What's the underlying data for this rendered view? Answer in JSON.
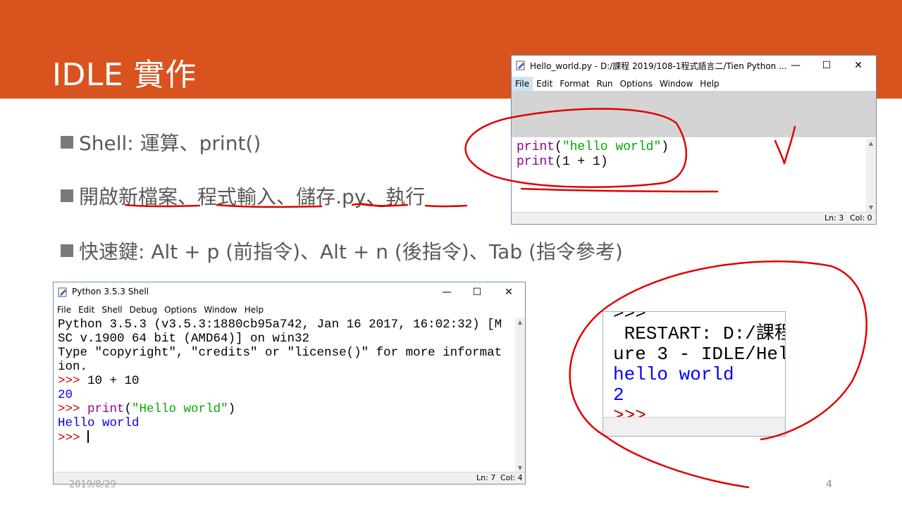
{
  "slide": {
    "title": "IDLE 實作",
    "bullets": [
      {
        "text": "Shell:  運算、print()"
      },
      {
        "parts": [
          "開啟",
          "新檔案",
          "、",
          "程式輸入",
          "、",
          "儲存",
          ".py",
          "、",
          "執行"
        ]
      },
      {
        "text": "快速鍵: Alt + p (前指令)、Alt + n (後指令)、Tab (指令參考)"
      }
    ],
    "date": "2019/8/29",
    "page_number": "4"
  },
  "editor_window": {
    "title": "Hello_world.py - D:/課程 2019/108-1程式語言二/Tien Python ...",
    "controls": {
      "minimize": "—",
      "maximize": "☐",
      "close": "✕"
    },
    "menu": [
      "File",
      "Edit",
      "Format",
      "Run",
      "Options",
      "Window",
      "Help"
    ],
    "code": {
      "line1": {
        "kw": "print",
        "open": "(",
        "str": "\"hello world\"",
        "close": ")"
      },
      "line2": {
        "kw": "print",
        "rest": "(1 + 1)"
      }
    },
    "status": {
      "ln": "Ln: 3",
      "col": "Col: 0"
    }
  },
  "shell_window": {
    "title": "Python 3.5.3 Shell",
    "controls": {
      "minimize": "—",
      "maximize": "☐",
      "close": "✕"
    },
    "menu": [
      "File",
      "Edit",
      "Shell",
      "Debug",
      "Options",
      "Window",
      "Help"
    ],
    "lines": {
      "l1": "Python 3.5.3 (v3.5.3:1880cb95a742, Jan 16 2017, 16:02:32) [M",
      "l2": "SC v.1900 64 bit (AMD64)] on win32",
      "l3": "Type \"copyright\", \"credits\" or \"license()\" for more informat",
      "l4": "ion.",
      "prompt": ">>> ",
      "cmd1": "10 + 10",
      "out1": "20",
      "cmd2_kw": "print",
      "cmd2_open": "(",
      "cmd2_str": "\"Hello world\"",
      "cmd2_close": ")",
      "out2": "Hello world"
    },
    "status": {
      "ln": "Ln: 7",
      "col": "Col: 4"
    }
  },
  "output_crop": {
    "top": ">>>",
    "l1": " RESTART: D:/課程",
    "l2": "ure 3 - IDLE/Hel",
    "out1": "hello world",
    "out2": "2",
    "prompt": ">>>"
  },
  "colors": {
    "banner": "#d9531e",
    "keyword": "#900090",
    "string": "#00aa00",
    "output": "#0000ff",
    "prompt": "#c00000",
    "ink": "#e00000"
  }
}
